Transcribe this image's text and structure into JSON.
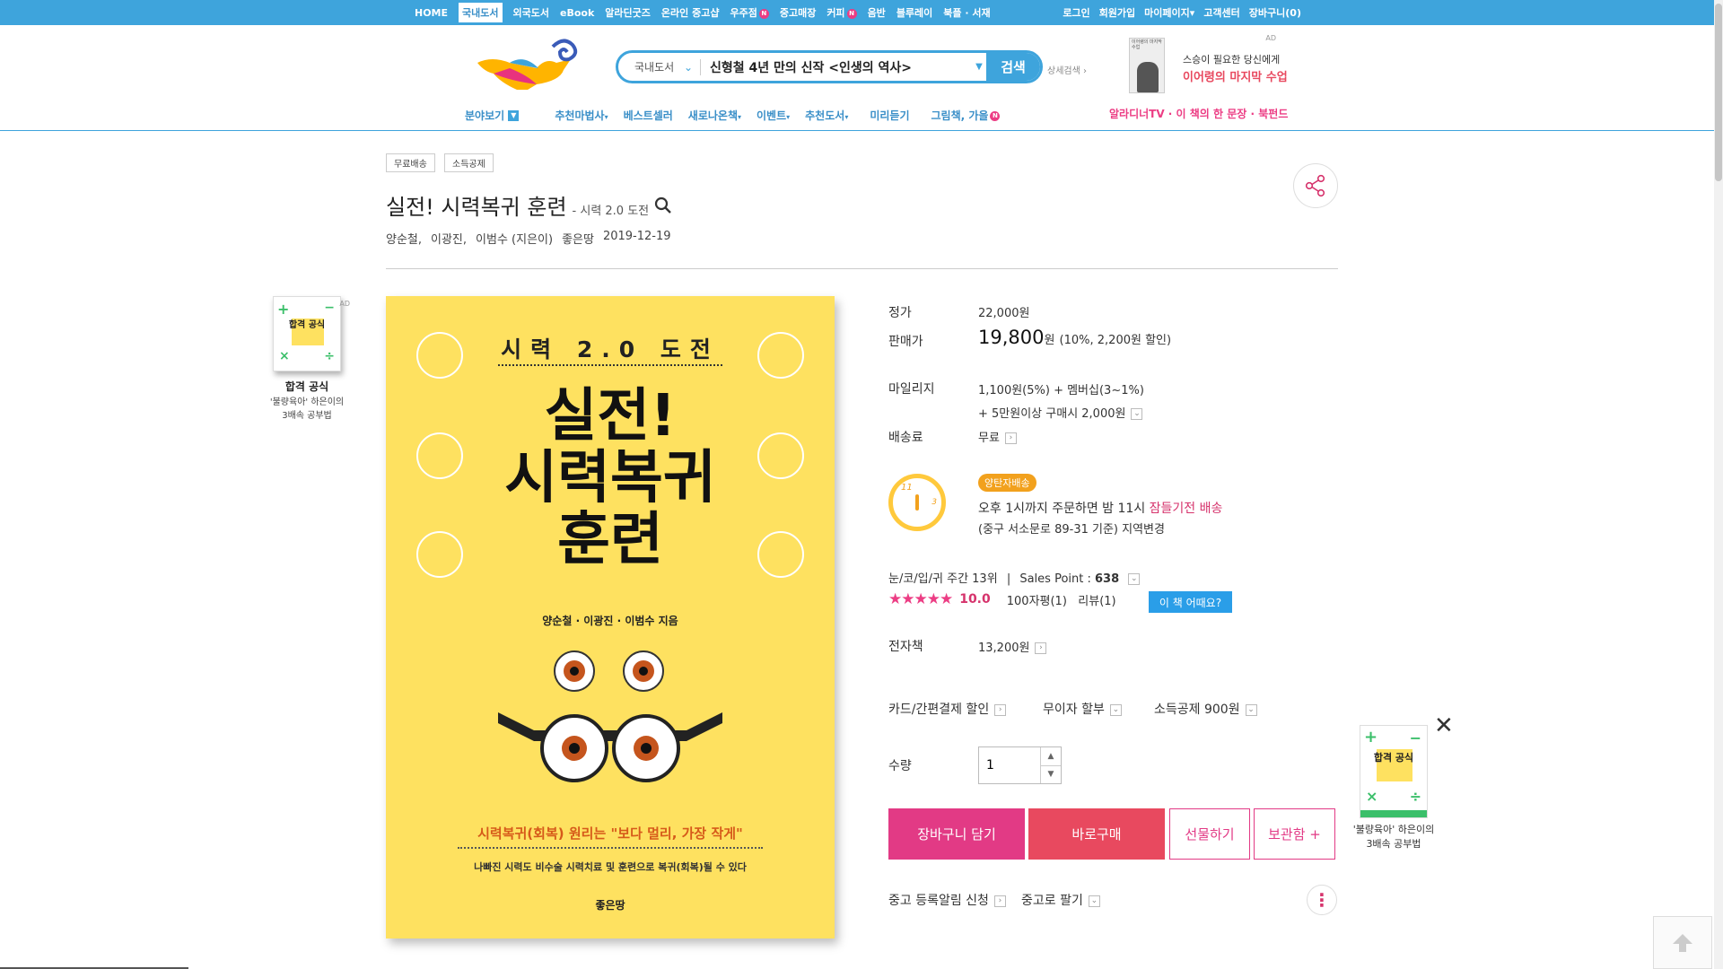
{
  "topnav": {
    "items": [
      {
        "label": "HOME"
      },
      {
        "label": "국내도서",
        "active": true
      },
      {
        "label": "외국도서"
      },
      {
        "label": "eBook"
      },
      {
        "label": "알라딘굿즈"
      },
      {
        "label": "온라인 중고샵"
      },
      {
        "label": "우주점",
        "badge": "N"
      },
      {
        "label": "중고매장"
      },
      {
        "label": "커피",
        "badge": "N"
      },
      {
        "label": "음반"
      },
      {
        "label": "블루레이"
      },
      {
        "label": "북플 · 서재"
      }
    ],
    "util": [
      "로그인",
      "회원가입",
      "마이페이지",
      "고객센터",
      "장바구니(0)"
    ],
    "mypage_caret": "▾"
  },
  "search": {
    "category": "국내도서",
    "category_caret": "⌄",
    "query": "신형철 4년 만의 신작 <인생의 역사>",
    "button": "검색",
    "advanced": "상세검색 ›"
  },
  "header_ad": {
    "label": "AD",
    "line1": "스승이 필요한 당신에게",
    "line2": "이어령의 마지막 수업",
    "cover_text": "이어령의 마지막 수업"
  },
  "catnav": {
    "items": [
      "분야보기",
      "추천마법사",
      "베스트셀러",
      "새로나온책",
      "이벤트",
      "추천도서",
      "미리듣기",
      "그림책, 가을"
    ],
    "promo": "알라디너TV · 이 책의 한 문장 · 북펀드"
  },
  "tags": [
    "무료배송",
    "소득공제"
  ],
  "book": {
    "title": "실전! 시력복귀 훈련",
    "subtitle": "- 시력 2.0 도전",
    "authors": [
      "양순철,",
      "이광진,",
      "이범수 (지은이)",
      "좋은땅",
      "2019-12-19"
    ]
  },
  "cover": {
    "top": "시력 2.0 도전",
    "title1": "실전!",
    "title2": "시력복귀",
    "title3": "훈련",
    "authors": "양순철 · 이광진 · 이범수 지음",
    "slogan": "시력복귀(회복) 원리는 \"보다 멀리, 가장 작게\"",
    "desc": "나빠진 시력도 비수술 시력치료 및 훈련으로 복귀(회복)될 수 있다",
    "publisher": "좋은땅"
  },
  "left_ad": {
    "label": "AD",
    "title": "합격 공식",
    "line1": "'불량육아' 하은이의",
    "line2": "3배속 공부법",
    "cover_title": "합격 공식"
  },
  "price": {
    "list_label": "정가",
    "list_value": "22,000원",
    "sale_label": "판매가",
    "sale_value": "19,800",
    "sale_unit": "원",
    "sale_note": "(10%, 2,200원 할인)",
    "mileage_label": "마일리지",
    "mileage_line1": "1,100원(5%) + 멤버십(3~1%)",
    "mileage_line2": "+ 5만원이상 구매시 2,000원",
    "shipping_label": "배송료",
    "shipping_value": "무료",
    "ebook_label": "전자책",
    "ebook_value": "13,200원"
  },
  "delivery": {
    "badge": "양탄자배송",
    "line1_a": "오후 1시까지 주문하면 밤 11시 ",
    "line1_b": "잠들기전 배송",
    "line2": "(중구 서소문로 89-31 기준) 지역변경",
    "clock_11": "11",
    "clock_3": "3"
  },
  "rank": {
    "text": "눈/코/입/귀 주간 13위",
    "sep": "|",
    "sales_label": "Sales Point : ",
    "sales_value": "638",
    "stars": "★★★★★",
    "score": "10.0",
    "reviews": "100자평(1)   리뷰(1)",
    "how_button": "이 책 어때요?"
  },
  "options": {
    "card": "카드/간편결제 할인",
    "installment": "무이자 할부",
    "tax": "소득공제 900원"
  },
  "quantity": {
    "label": "수량",
    "value": "1"
  },
  "buttons": {
    "cart": "장바구니 담기",
    "buy": "바로구매",
    "gift": "선물하기",
    "keep": "보관함 +"
  },
  "used": {
    "alert": "중고 등록알림 신청",
    "sell": "중고로 팔기"
  },
  "right_ad": {
    "title": "합격 공식",
    "line1": "'불량육아' 하은이의",
    "line2": "3배속 공부법"
  },
  "glyphs": {
    "arrow_right": "›",
    "caret_down": "⌄",
    "close": "✕",
    "dots": "⋮"
  },
  "colors": {
    "brand_blue": "#3ea4dc",
    "pink": "#e23a85",
    "red": "#e8495f",
    "cover_yellow": "#fee160",
    "orange": "#f2a11d"
  }
}
